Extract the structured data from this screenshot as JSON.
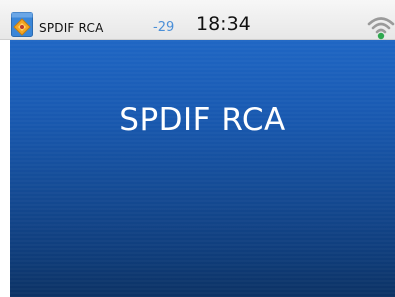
{
  "status_bar": {
    "source_label": "SPDIF RCA",
    "volume": "-29",
    "time": "18:34",
    "source_icon": "spdif-input-icon",
    "wifi_icon": "wifi-signal-icon"
  },
  "main": {
    "title": "SPDIF RCA"
  },
  "colors": {
    "accent": "#4a8fd8",
    "panel_blue": "#1959b0",
    "icon_orange": "#f5a623"
  }
}
